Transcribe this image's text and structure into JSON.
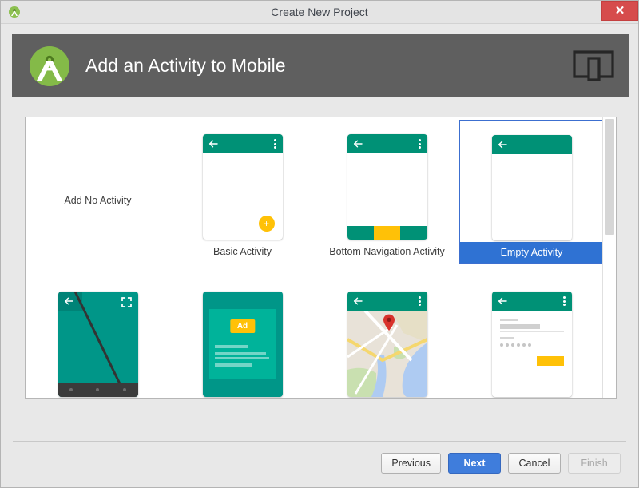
{
  "window": {
    "title": "Create New Project",
    "app_icon": "android-studio-icon",
    "close_label": "✕"
  },
  "header": {
    "title": "Add an Activity to Mobile",
    "logo_icon": "android-studio-logo",
    "device_icon": "mobile-device-icon",
    "background_color": "#5f5f5f"
  },
  "colors": {
    "accent_teal": "#009176",
    "accent_amber": "#ffc107",
    "selection_blue": "#2f72d3",
    "header_gray": "#5f5f5f",
    "close_red": "#d64c4c"
  },
  "templates": [
    {
      "id": "no-activity",
      "label": "Add No Activity",
      "selected": false,
      "preview": "none"
    },
    {
      "id": "basic-activity",
      "label": "Basic Activity",
      "selected": false,
      "preview": "basic"
    },
    {
      "id": "bottom-navigation",
      "label": "Bottom Navigation Activity",
      "selected": false,
      "preview": "bottomnav"
    },
    {
      "id": "empty-activity",
      "label": "Empty Activity",
      "selected": true,
      "preview": "empty"
    },
    {
      "id": "fullscreen-activity",
      "label": "",
      "selected": false,
      "preview": "fullscreen"
    },
    {
      "id": "ads-activity",
      "label": "",
      "selected": false,
      "preview": "ads"
    },
    {
      "id": "maps-activity",
      "label": "",
      "selected": false,
      "preview": "maps"
    },
    {
      "id": "login-activity",
      "label": "",
      "selected": false,
      "preview": "login"
    }
  ],
  "ads_preview": {
    "badge_label": "Ad"
  },
  "footer": {
    "previous_label": "Previous",
    "next_label": "Next",
    "cancel_label": "Cancel",
    "finish_label": "Finish",
    "finish_enabled": false
  }
}
